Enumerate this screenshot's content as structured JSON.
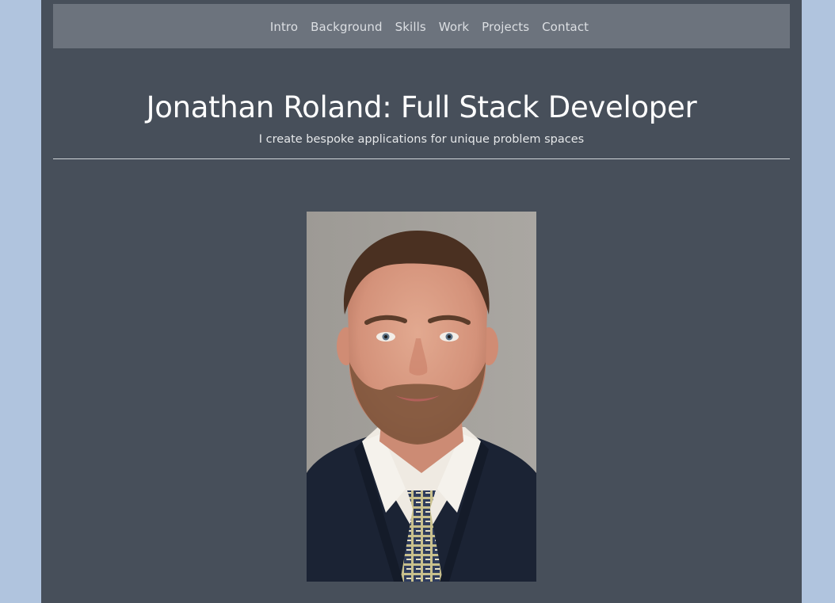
{
  "nav": {
    "items": [
      {
        "label": "Intro"
      },
      {
        "label": "Background"
      },
      {
        "label": "Skills"
      },
      {
        "label": "Work"
      },
      {
        "label": "Projects"
      },
      {
        "label": "Contact"
      }
    ]
  },
  "header": {
    "title": "Jonathan Roland: Full Stack Developer",
    "subtitle": "I create bespoke applications for unique problem spaces"
  },
  "colors": {
    "outer_background": "#b0c4de",
    "page_background": "#474f5a",
    "navbar_background": "#6c737d"
  },
  "portrait": {
    "icon": "headshot-photo"
  }
}
